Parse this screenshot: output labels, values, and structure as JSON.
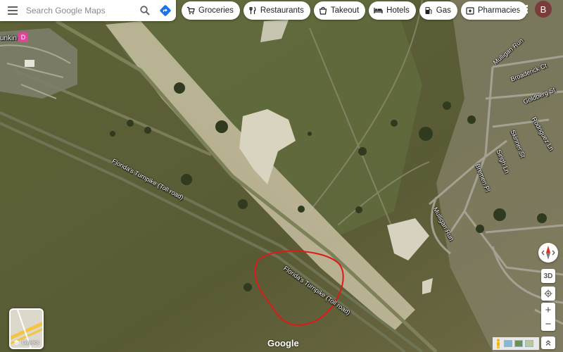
{
  "search": {
    "placeholder": "Search Google Maps"
  },
  "chips": [
    {
      "label": "Groceries",
      "icon": "cart-icon"
    },
    {
      "label": "Restaurants",
      "icon": "fork-knife-icon"
    },
    {
      "label": "Takeout",
      "icon": "takeout-bag-icon"
    },
    {
      "label": "Hotels",
      "icon": "bed-icon"
    },
    {
      "label": "Gas",
      "icon": "gas-pump-icon"
    },
    {
      "label": "Pharmacies",
      "icon": "pharmacy-icon"
    }
  ],
  "account": {
    "initial": "B"
  },
  "map_labels": {
    "poi": "unkin",
    "turnpike_upper": "Florida's Turnpike (Toll road)",
    "turnpike_lower": "Florida's Turnpike (Toll road)",
    "streets": [
      "Mulligan Run",
      "Broaderick Ct",
      "Goldberg St",
      "Rodriguez Ln",
      "Skinner St",
      "Singh Ln",
      "Bremen Pl",
      "Mulligan Run"
    ]
  },
  "controls": {
    "three_d": "3D",
    "zoom_in": "+",
    "zoom_out": "−"
  },
  "layers": {
    "label": "Layers"
  },
  "branding": {
    "logo": "Google"
  },
  "colors": {
    "annotation_circle": "#e01818",
    "account_bg": "#7b3b3b",
    "dd_pink": "#e0439a"
  }
}
